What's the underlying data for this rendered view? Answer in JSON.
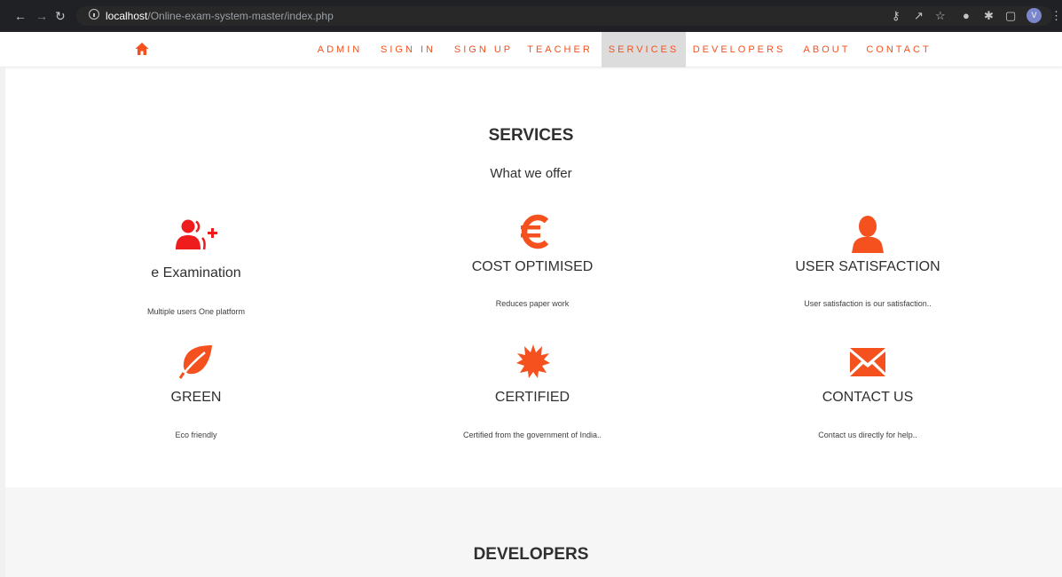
{
  "browser": {
    "url_host": "localhost",
    "url_path": "/Online-exam-system-master/index.php",
    "avatar_letter": "V"
  },
  "nav": {
    "items": [
      "ADMIN",
      "SIGN IN",
      "SIGN UP",
      "TEACHER",
      "SERVICES",
      "DEVELOPERS",
      "ABOUT",
      "CONTACT"
    ],
    "active": "SERVICES",
    "accent_color": "#f4511e"
  },
  "services": {
    "title": "SERVICES",
    "subtitle": "What we offer",
    "items": [
      {
        "icon": "add-user-icon",
        "title": "e Examination",
        "desc": "Multiple users One platform"
      },
      {
        "icon": "euro-icon",
        "title": "COST OPTIMISED",
        "desc": "Reduces paper work"
      },
      {
        "icon": "user-icon",
        "title": "USER SATISFACTION",
        "desc": "User satisfaction is our satisfaction.."
      },
      {
        "icon": "leaf-icon",
        "title": "GREEN",
        "desc": "Eco friendly"
      },
      {
        "icon": "certificate-icon",
        "title": "CERTIFIED",
        "desc": "Certified from the government of India.."
      },
      {
        "icon": "envelope-icon",
        "title": "CONTACT US",
        "desc": "Contact us directly for help.."
      }
    ]
  },
  "developers": {
    "title": "DEVELOPERS"
  }
}
